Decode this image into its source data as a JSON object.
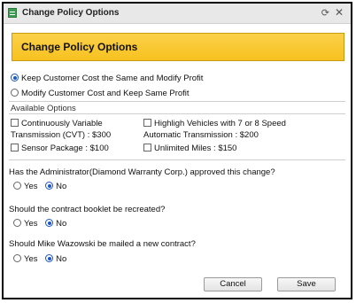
{
  "window": {
    "title": "Change Policy Options",
    "icons": {
      "app": "app-icon",
      "restore": "restore-icon",
      "close": "close-icon"
    }
  },
  "banner": {
    "title": "Change Policy Options"
  },
  "mode_options": [
    {
      "label": "Keep Customer Cost the Same and Modify Profit",
      "selected": true
    },
    {
      "label": "Modify Customer Cost and Keep Same Profit",
      "selected": false
    }
  ],
  "available_options": {
    "heading": "Available Options",
    "items": [
      {
        "line1": "Continuously Variable",
        "line2": "Transmission (CVT) : $300",
        "checked": false
      },
      {
        "line1": "Highligh Vehicles with 7 or 8 Speed",
        "line2": "Automatic Transmission : $200",
        "checked": false
      },
      {
        "line1": "Sensor Package : $100",
        "checked": false
      },
      {
        "line1": "Unlimited Miles : $150",
        "checked": false
      }
    ]
  },
  "questions": [
    {
      "text": "Has the Administrator(Diamond Warranty Corp.) approved this change?",
      "yes": "Yes",
      "no": "No",
      "selected": "No"
    },
    {
      "text": "Should the contract booklet be recreated?",
      "yes": "Yes",
      "no": "No",
      "selected": "No"
    },
    {
      "text": "Should Mike Wazowski be mailed a new contract?",
      "yes": "Yes",
      "no": "No",
      "selected": "No"
    }
  ],
  "buttons": {
    "cancel": "Cancel",
    "save": "Save"
  }
}
